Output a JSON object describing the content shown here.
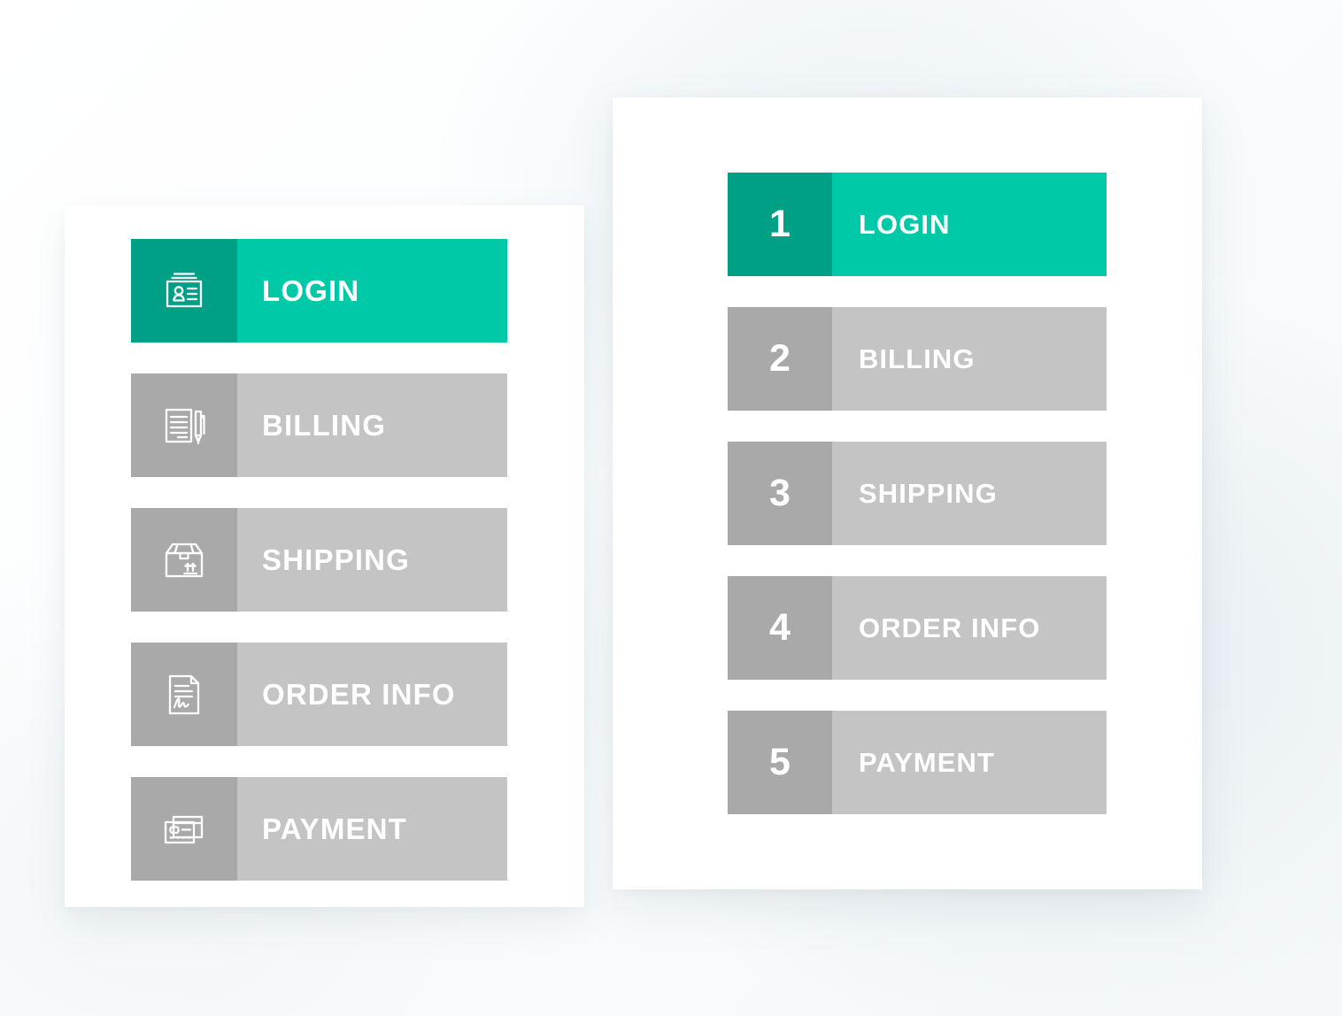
{
  "background": {
    "base_color": "#ffffff",
    "tint_color": "#eef3f6"
  },
  "palette": {
    "active_lead": "#00a086",
    "active_body": "#00c9a7",
    "idle_lead": "#a9a9a9",
    "idle_body": "#c4c4c4",
    "label_color": "#ffffff",
    "card_background": "#ffffff"
  },
  "checkout_progress_icon_variant": {
    "variant_name": "icon-steps",
    "steps": [
      {
        "label": "LOGIN",
        "icon": "id-card-icon",
        "state": "active"
      },
      {
        "label": "BILLING",
        "icon": "document-pen-icon",
        "state": "idle"
      },
      {
        "label": "SHIPPING",
        "icon": "shipping-box-icon",
        "state": "idle"
      },
      {
        "label": "ORDER INFO",
        "icon": "signed-document-icon",
        "state": "idle"
      },
      {
        "label": "PAYMENT",
        "icon": "credit-cards-icon",
        "state": "idle"
      }
    ]
  },
  "checkout_progress_number_variant": {
    "variant_name": "numbered-steps",
    "steps": [
      {
        "number": "1",
        "label": "LOGIN",
        "state": "active"
      },
      {
        "number": "2",
        "label": "BILLING",
        "state": "idle"
      },
      {
        "number": "3",
        "label": "SHIPPING",
        "state": "idle"
      },
      {
        "number": "4",
        "label": "ORDER INFO",
        "state": "idle"
      },
      {
        "number": "5",
        "label": "PAYMENT",
        "state": "idle"
      }
    ]
  }
}
